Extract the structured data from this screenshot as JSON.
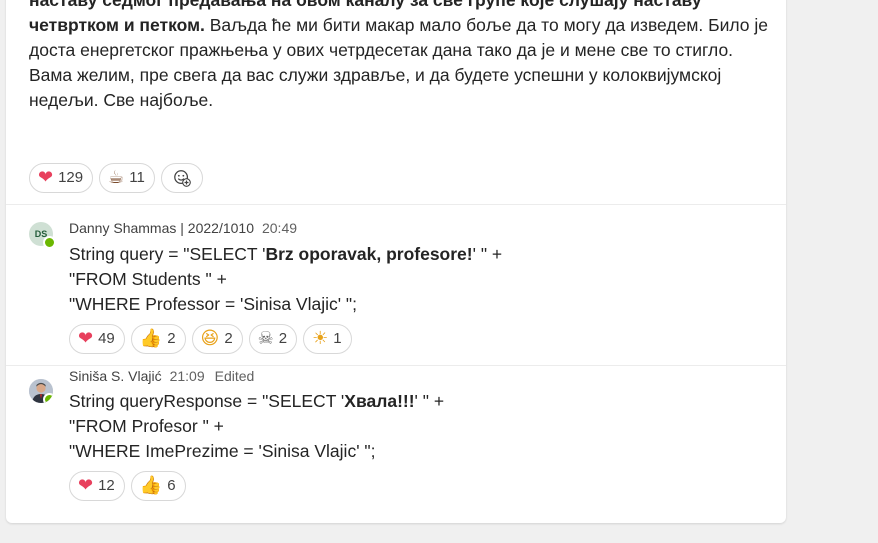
{
  "post": {
    "line1_bold": "наставу седмог предавања на овом каналу за све групе које слушају наставу",
    "line2_bold": "четвртком и петком.",
    "line2_rest": " Ваљда ће ми бити макар мало боље да то могу да изведем. Било је",
    "line3": "доста енергетског пражњења у ових четрдесетак дана тако да је и мене све то стигло.",
    "line4": "Вама желим, пре свега да вас служи здравље, и да будете успешни у колоквијумској",
    "line5": "недељи. Све најбоље.",
    "reactions": [
      {
        "icon": "heart-icon",
        "glyph": "❤",
        "color": "#e8405d",
        "count": "129"
      },
      {
        "icon": "coffee-icon",
        "glyph": "☕",
        "color": "#7a4a2b",
        "count": "11"
      }
    ]
  },
  "replies": [
    {
      "initials": "DS",
      "author": "Danny Shammas | 2022/1010",
      "time": "20:49",
      "edited": "",
      "lines": [
        {
          "a": "String query = \"SELECT '",
          "b": "Brz oporavak, profesore!",
          "c": "' \" +"
        },
        {
          "a": "\"FROM Students \" +",
          "b": "",
          "c": ""
        },
        {
          "a": "\"WHERE Professor = 'Sinisa Vlajic' \";",
          "b": "",
          "c": ""
        }
      ],
      "reactions": [
        {
          "icon": "heart-icon",
          "glyph": "❤",
          "color": "#e8405d",
          "count": "49"
        },
        {
          "icon": "thumbs-up-icon",
          "glyph": "👍",
          "color": "#e8a21a",
          "count": "2"
        },
        {
          "icon": "laughing-face-icon",
          "glyph": "😆",
          "color": "#e8a21a",
          "count": "2"
        },
        {
          "icon": "skull-icon",
          "glyph": "☠",
          "color": "#6b6b6b",
          "count": "2"
        },
        {
          "icon": "sun-face-icon",
          "glyph": "☀",
          "color": "#e8a21a",
          "count": "1"
        }
      ]
    },
    {
      "initials": "",
      "author": "Siniša S. Vlajić",
      "time": "21:09",
      "edited": "Edited",
      "lines": [
        {
          "a": "String queryResponse = \"SELECT '",
          "b": "Хвала!!!",
          "c": "' \" +"
        },
        {
          "a": "\"FROM Profesor \" +",
          "b": "",
          "c": ""
        },
        {
          "a": "\"WHERE ImePrezime = 'Sinisa Vlajic' \";",
          "b": "",
          "c": ""
        }
      ],
      "reactions": [
        {
          "icon": "heart-icon",
          "glyph": "❤",
          "color": "#e8405d",
          "count": "12"
        },
        {
          "icon": "thumbs-up-icon",
          "glyph": "👍",
          "color": "#e8a21a",
          "count": "6"
        }
      ]
    }
  ]
}
